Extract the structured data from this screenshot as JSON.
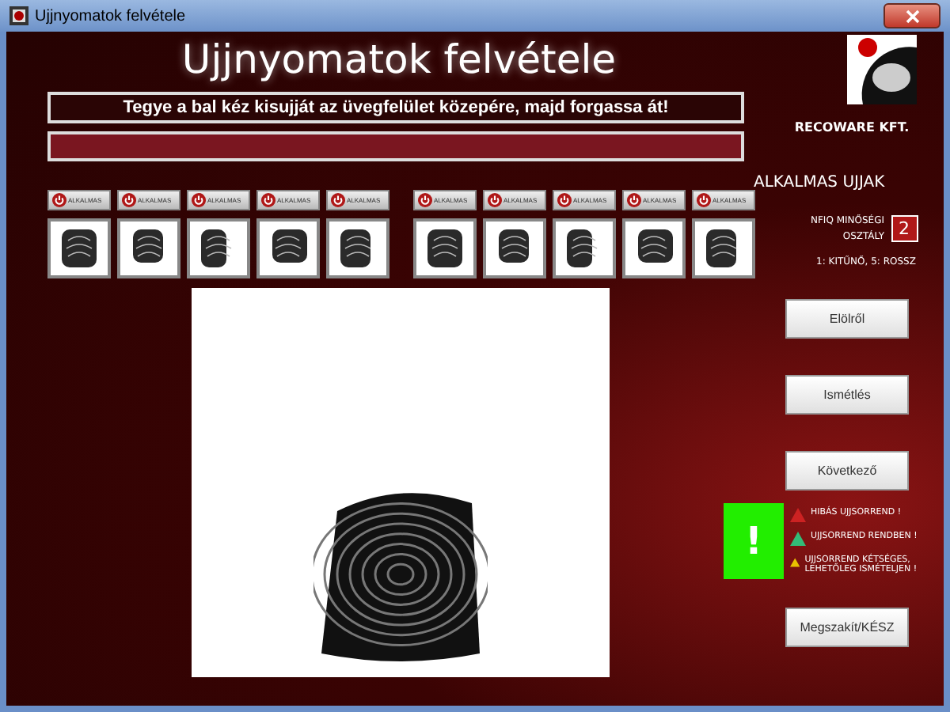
{
  "window": {
    "title": "Ujjnyomatok felvétele"
  },
  "heading": "Ujjnyomatok felvétele",
  "instruction": "Tegye a bal kéz kisujját az üvegfelület közepére, majd forgassa át!",
  "company": "RECOWARE KFT.",
  "finger_groups": [
    {
      "slots": [
        {
          "label": "ALKALMAS"
        },
        {
          "label": "ALKALMAS"
        },
        {
          "label": "ALKALMAS"
        },
        {
          "label": "ALKALMAS"
        },
        {
          "label": "ALKALMAS"
        }
      ]
    },
    {
      "slots": [
        {
          "label": "ALKALMAS"
        },
        {
          "label": "ALKALMAS"
        },
        {
          "label": "ALKALMAS"
        },
        {
          "label": "ALKALMAS"
        },
        {
          "label": "ALKALMAS"
        }
      ]
    }
  ],
  "side": {
    "title": "ALKALMAS UJJAK",
    "nfiq_label": "NFIQ MINŐSÉGI OSZTÁLY",
    "nfiq_value": "2",
    "nfiq_scale": "1: KITŰNŐ, 5: ROSSZ"
  },
  "buttons": [
    "Elölről",
    "Ismétlés",
    "Következő",
    "Megszakít/KÉSZ"
  ],
  "status": {
    "symbol": "!",
    "color": "#22ee00"
  },
  "legend": [
    {
      "text": "HIBÁS UJJSORREND !",
      "color": "#cc2222"
    },
    {
      "text": "UJJSORREND RENDBEN !",
      "color": "#33bb77"
    },
    {
      "text": "UJJSORREND KÉTSÉGES, LEHETŐLEG ISMÉTELJEN !",
      "color": "#e8c000"
    }
  ]
}
